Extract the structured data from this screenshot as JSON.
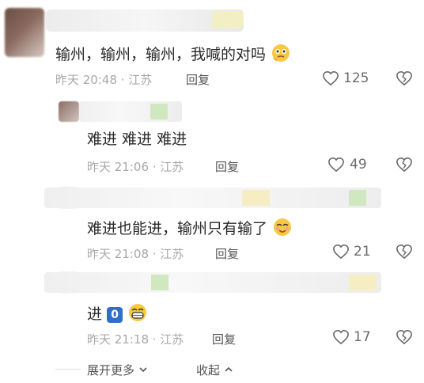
{
  "comment": {
    "text": "输州，输州，输州，我喊的对吗",
    "time": "昨天 20:48 · 江苏",
    "reply": "回复",
    "likes": "125"
  },
  "replies": [
    {
      "text": "难进 难进 难进",
      "time": "昨天 21:06 · 江苏",
      "reply": "回复",
      "likes": "49"
    },
    {
      "text": "难进也能进，输州只有输了",
      "time": "昨天 21:08 · 江苏",
      "reply": "回复",
      "likes": "21"
    },
    {
      "text": "进",
      "badge": "0",
      "time": "昨天 21:18 · 江苏",
      "reply": "回复",
      "likes": "17"
    }
  ],
  "footer": {
    "expand": "展开更多",
    "collapse": "收起"
  },
  "icons": [
    "heart-outline-icon",
    "broken-heart-icon",
    "thinking-emoji-icon",
    "smiling-emoji-icon",
    "grinning-emoji-icon",
    "chevron-down-icon",
    "chevron-up-icon"
  ]
}
